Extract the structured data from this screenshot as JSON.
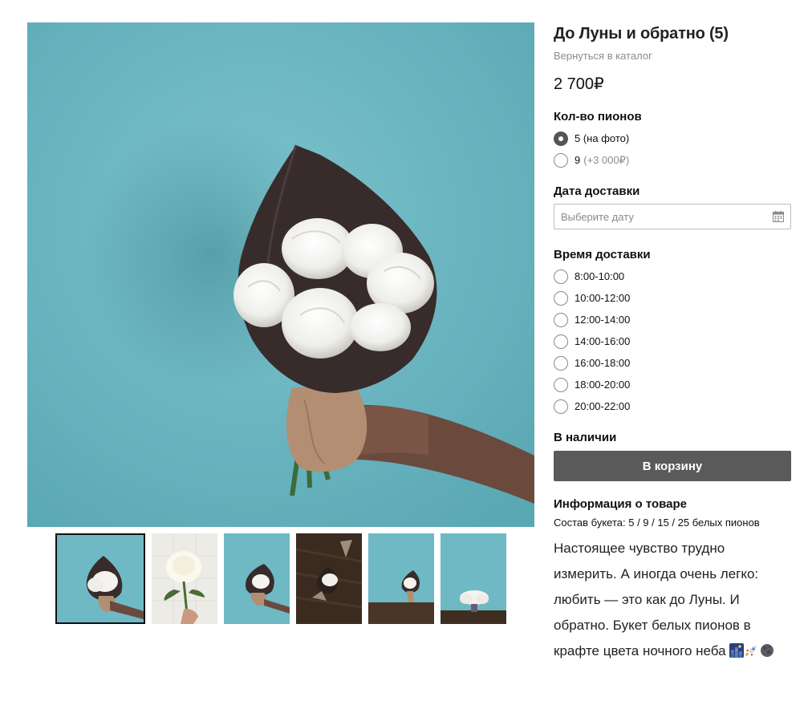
{
  "product": {
    "title": "До Луны и обратно (5)",
    "back_link": "Вернуться в каталог",
    "price": "2 700₽"
  },
  "quantity": {
    "label": "Кол-во пионов",
    "options": [
      {
        "label": "5 (на фото)",
        "extra": "",
        "selected": true
      },
      {
        "label": "9",
        "extra": "(+3 000₽)",
        "selected": false
      }
    ]
  },
  "delivery_date": {
    "label": "Дата доставки",
    "placeholder": "Выберите дату"
  },
  "delivery_time": {
    "label": "Время доставки",
    "options": [
      "8:00-10:00",
      "10:00-12:00",
      "12:00-14:00",
      "14:00-16:00",
      "16:00-18:00",
      "18:00-20:00",
      "20:00-22:00"
    ]
  },
  "stock_status": "В наличии",
  "cart_button": "В корзину",
  "info": {
    "heading": "Информация о товаре",
    "composition": "Состав букета: 5 / 9 / 15 / 25 белых пионов",
    "description": "Настоящее чувство трудно измерить. А иногда очень легко: любить — это как до Луны. И обратно. Букет белых пионов в крафте цвета ночного неба"
  },
  "gallery": {
    "thumbnail_count": 6,
    "active_index": 0,
    "colors": {
      "teal_background": "#6fb9c4",
      "kraft_dark": "#3a2f2e",
      "kraft_light": "#b08c72"
    }
  },
  "icons": {
    "calendar": "calendar-icon",
    "description_emoji": [
      "night-city-emoji-icon",
      "rocket-emoji-icon",
      "moon-emoji-icon"
    ]
  }
}
